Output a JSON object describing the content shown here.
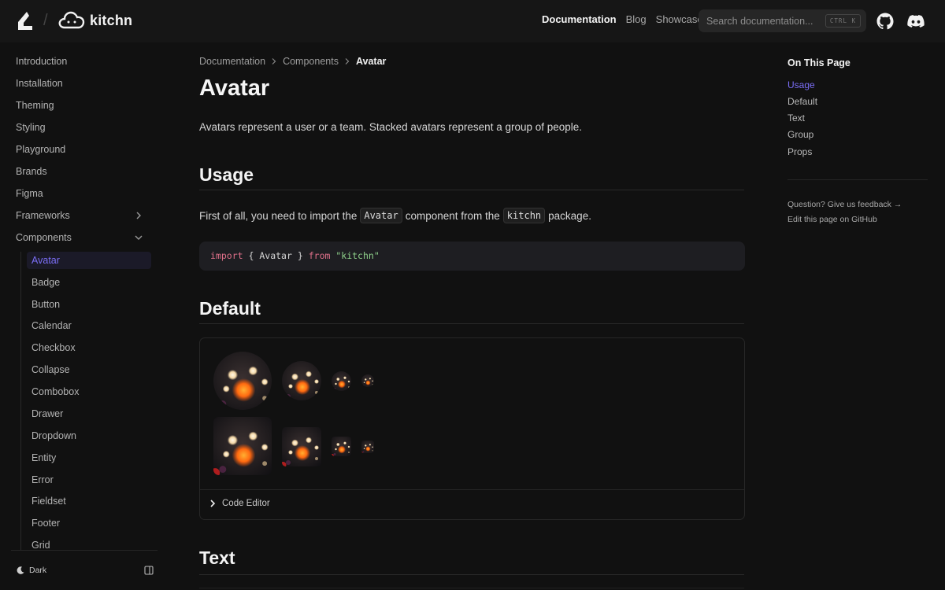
{
  "header": {
    "brand": "kitchn",
    "nav": [
      {
        "label": "Documentation",
        "active": true
      },
      {
        "label": "Blog",
        "active": false
      },
      {
        "label": "Showcase",
        "active": false
      }
    ],
    "search_placeholder": "Search documentation...",
    "search_shortcut": "CTRL K"
  },
  "sidebar": {
    "items": [
      {
        "label": "Introduction"
      },
      {
        "label": "Installation"
      },
      {
        "label": "Theming"
      },
      {
        "label": "Styling"
      },
      {
        "label": "Playground"
      },
      {
        "label": "Brands"
      },
      {
        "label": "Figma"
      },
      {
        "label": "Frameworks",
        "icon": "chevron-right-icon"
      },
      {
        "label": "Components",
        "icon": "chevron-down-icon"
      }
    ],
    "components": [
      "Avatar",
      "Badge",
      "Button",
      "Calendar",
      "Checkbox",
      "Collapse",
      "Combobox",
      "Drawer",
      "Dropdown",
      "Entity",
      "Error",
      "Fieldset",
      "Footer",
      "Grid"
    ],
    "active_component": "Avatar",
    "theme_label": "Dark"
  },
  "main": {
    "breadcrumb": [
      "Documentation",
      "Components",
      "Avatar"
    ],
    "title": "Avatar",
    "lead": "Avatars represent a user or a team. Stacked avatars represent a group of people.",
    "usage": {
      "heading": "Usage",
      "text_before": "First of all, you need to import the",
      "code1": "Avatar",
      "text_middle": "component from the",
      "code2": "kitchn",
      "text_after": "package."
    },
    "code": {
      "kw1": "import",
      "open": "{",
      "ident": "Avatar",
      "close": "}",
      "kw2": "from",
      "str": "\"kitchn\""
    },
    "default_heading": "Default",
    "code_editor_label": "Code Editor",
    "text_heading": "Text"
  },
  "toc": {
    "title": "On This Page",
    "items": [
      "Usage",
      "Default",
      "Text",
      "Group",
      "Props"
    ],
    "active": "Usage",
    "feedback": "Question? Give us feedback →",
    "edit": "Edit this page on GitHub"
  },
  "colors": {
    "accent": "#7b6ef6",
    "background": "#111111",
    "header": "#161616"
  }
}
